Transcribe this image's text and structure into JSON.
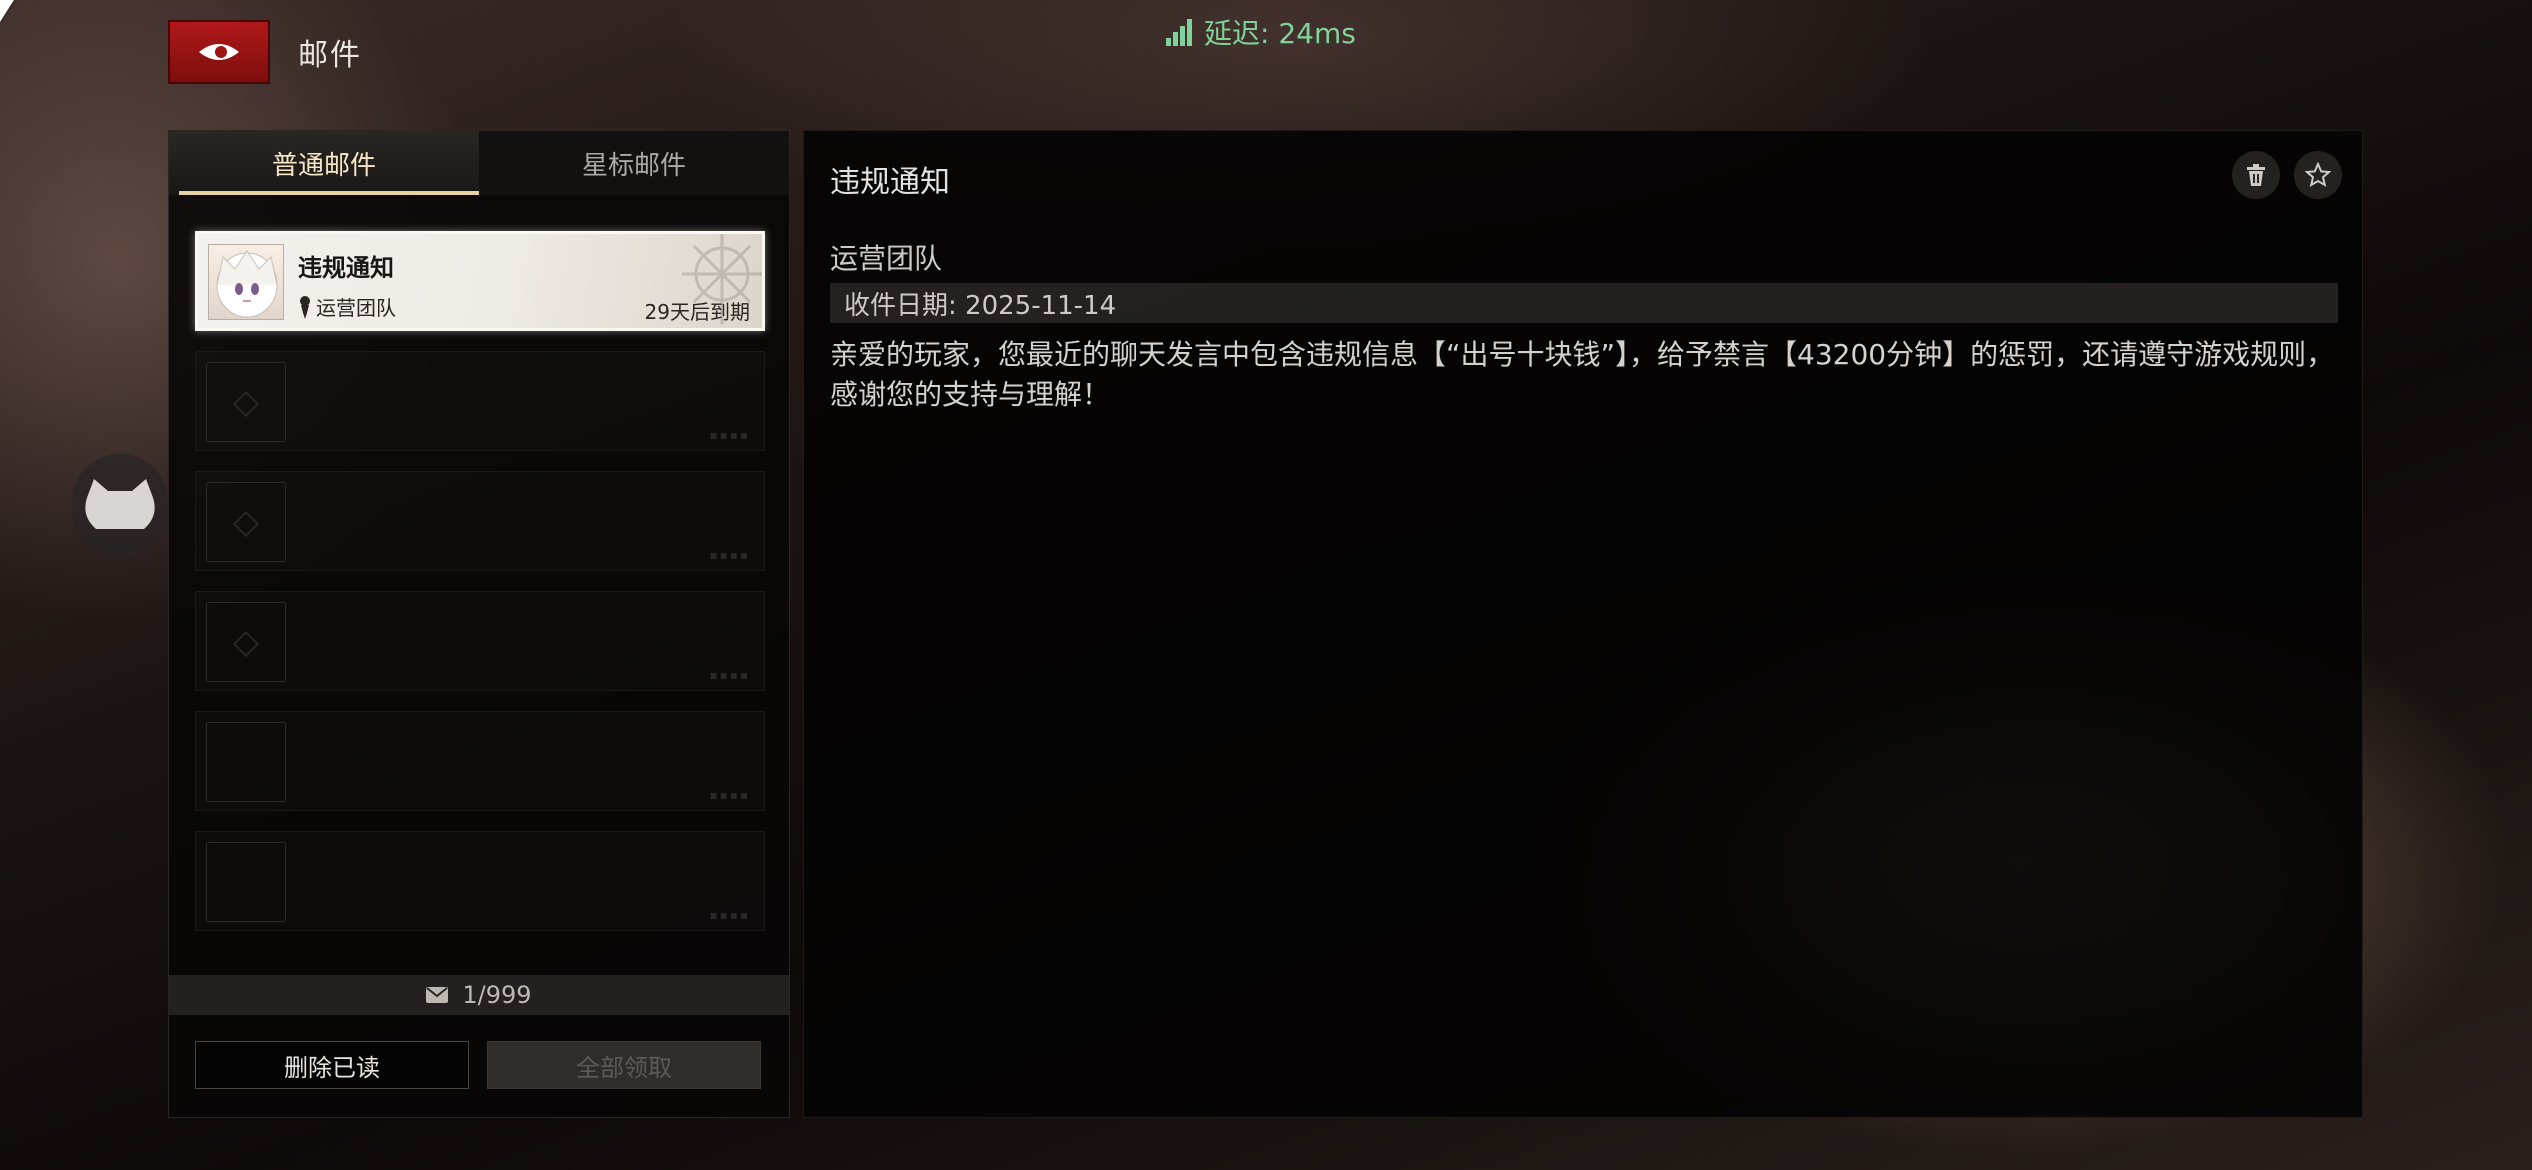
{
  "header": {
    "back_icon": "back-eye-icon",
    "title": "邮件",
    "latency_label": "延迟: 24ms",
    "latency_icon": "signal-bars-icon",
    "latency_color": "#7fd39a"
  },
  "tabs": [
    {
      "label": "普通邮件",
      "active": true
    },
    {
      "label": "星标邮件",
      "active": false
    }
  ],
  "mail_list": {
    "selected": {
      "subject": "违规通知",
      "sender": "运营团队",
      "expiry": "29天后到期"
    },
    "empty_slots": 5
  },
  "footer": {
    "count": "1/999",
    "delete_read_label": "删除已读",
    "claim_all_label": "全部领取"
  },
  "detail": {
    "title": "违规通知",
    "sender": "运营团队",
    "date": "收件日期: 2025-11-14",
    "body": "亲爱的玩家，您最近的聊天发言中包含违规信息【“出号十块钱”】，给予禁言【43200分钟】的惩罚，还请遵守游戏规则，感谢您的支持与理解！",
    "delete_icon": "trash-icon",
    "star_icon": "star-icon"
  },
  "accent_colors": {
    "back_button": "#a01414",
    "tab_underline": "#e5d3a4"
  }
}
